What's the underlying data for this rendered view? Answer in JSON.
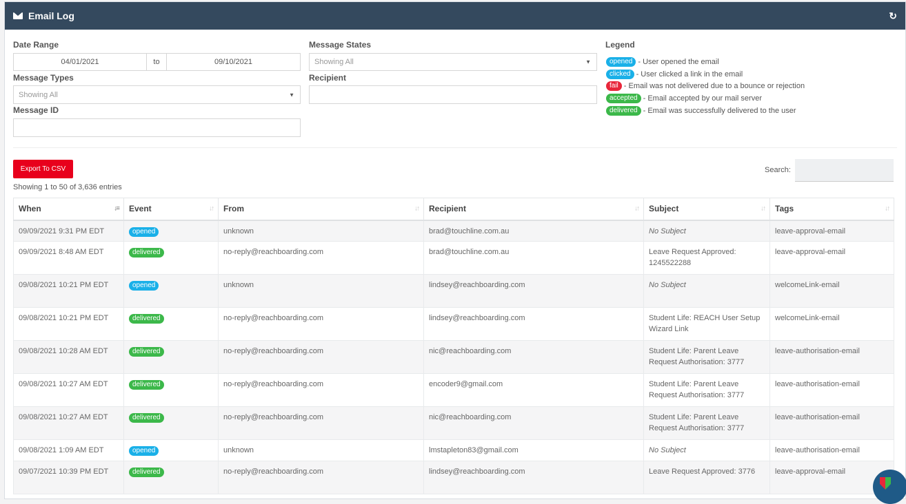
{
  "header": {
    "title": "Email Log",
    "refresh_icon": "refresh-icon"
  },
  "filters": {
    "date_range_label": "Date Range",
    "date_from": "04/01/2021",
    "to_label": "to",
    "date_to": "09/10/2021",
    "message_types_label": "Message Types",
    "message_types_value": "Showing All",
    "message_id_label": "Message ID",
    "message_states_label": "Message States",
    "message_states_value": "Showing All",
    "recipient_label": "Recipient"
  },
  "legend": {
    "title": "Legend",
    "items": [
      {
        "badge": "opened",
        "color": "#1ab0e8",
        "text": "- User opened the email"
      },
      {
        "badge": "clicked",
        "color": "#1ab0e8",
        "text": "- User clicked a link in the email"
      },
      {
        "badge": "fail",
        "color": "#e8263a",
        "text": "- Email was not delivered due to a bounce or rejection"
      },
      {
        "badge": "accepted",
        "color": "#3cb84a",
        "text": "- Email accepted by our mail server"
      },
      {
        "badge": "delivered",
        "color": "#3cb84a",
        "text": "- Email was successfully delivered to the user"
      }
    ]
  },
  "toolbar": {
    "export_label": "Export To CSV",
    "search_label": "Search:"
  },
  "table": {
    "info": "Showing 1 to 50 of 3,636 entries",
    "columns": [
      "When",
      "Event",
      "From",
      "Recipient",
      "Subject",
      "Tags"
    ],
    "rows": [
      {
        "when": "09/09/2021 9:31 PM EDT",
        "event": "opened",
        "from": "unknown",
        "recipient": "brad@touchline.com.au",
        "subject": "No Subject",
        "tags": "leave-approval-email"
      },
      {
        "when": "09/09/2021 8:48 AM EDT",
        "event": "delivered",
        "from": "no-reply@reachboarding.com",
        "recipient": "brad@touchline.com.au",
        "subject": "Leave Request Approved: 1245522288",
        "tags": "leave-approval-email"
      },
      {
        "when": "09/08/2021 10:21 PM EDT",
        "event": "opened",
        "from": "unknown",
        "recipient": "lindsey@reachboarding.com",
        "subject": "No Subject",
        "tags": "welcomeLink-email"
      },
      {
        "when": "09/08/2021 10:21 PM EDT",
        "event": "delivered",
        "from": "no-reply@reachboarding.com",
        "recipient": "lindsey@reachboarding.com",
        "subject": "Student Life: REACH User Setup Wizard Link",
        "tags": "welcomeLink-email"
      },
      {
        "when": "09/08/2021 10:28 AM EDT",
        "event": "delivered",
        "from": "no-reply@reachboarding.com",
        "recipient": "nic@reachboarding.com",
        "subject": "Student Life: Parent Leave Request Authorisation: 3777",
        "tags": "leave-authorisation-email"
      },
      {
        "when": "09/08/2021 10:27 AM EDT",
        "event": "delivered",
        "from": "no-reply@reachboarding.com",
        "recipient": "encoder9@gmail.com",
        "subject": "Student Life: Parent Leave Request Authorisation: 3777",
        "tags": "leave-authorisation-email"
      },
      {
        "when": "09/08/2021 10:27 AM EDT",
        "event": "delivered",
        "from": "no-reply@reachboarding.com",
        "recipient": "nic@reachboarding.com",
        "subject": "Student Life: Parent Leave Request Authorisation: 3777",
        "tags": "leave-authorisation-email"
      },
      {
        "when": "09/08/2021 1:09 AM EDT",
        "event": "opened",
        "from": "unknown",
        "recipient": "lmstapleton83@gmail.com",
        "subject": "No Subject",
        "tags": "leave-authorisation-email"
      },
      {
        "when": "09/07/2021 10:39 PM EDT",
        "event": "delivered",
        "from": "no-reply@reachboarding.com",
        "recipient": "lindsey@reachboarding.com",
        "subject": "Leave Request Approved: 3776",
        "tags": "leave-approval-email"
      }
    ]
  }
}
